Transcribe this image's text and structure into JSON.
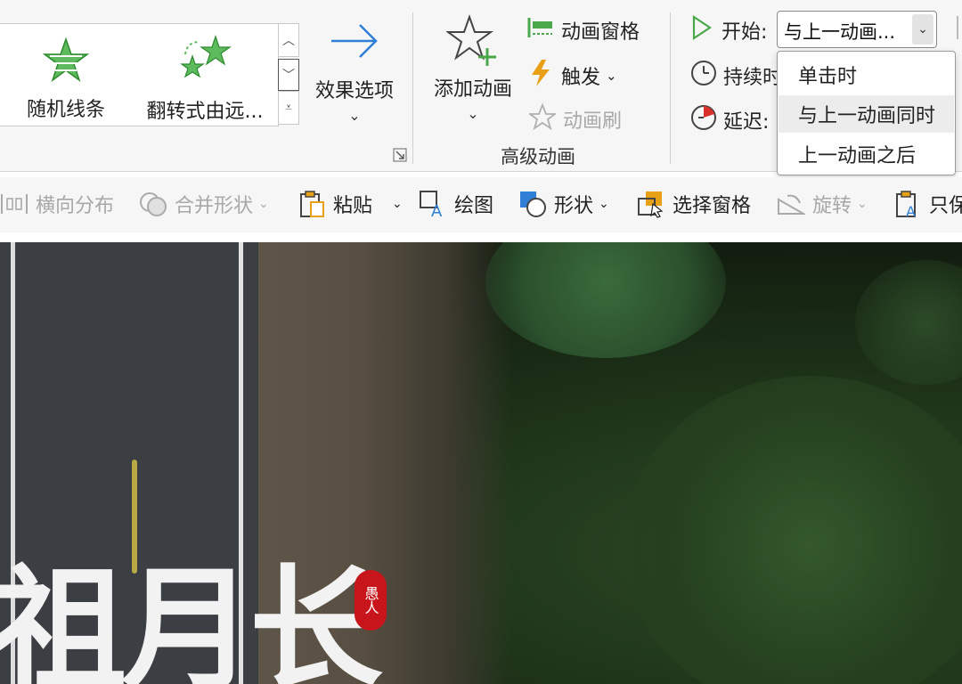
{
  "ribbon": {
    "gallery": {
      "items": [
        {
          "label": "随机线条",
          "icon": "random-bars-star-icon"
        },
        {
          "label": "翻转式由远...",
          "icon": "flip-stars-icon"
        }
      ]
    },
    "effect_options": {
      "label": "效果选项",
      "icon": "effect-options-arrow-icon"
    },
    "advanced_animation": {
      "group_label": "高级动画",
      "add_animation": {
        "label": "添加动画",
        "icon": "add-animation-star-icon"
      },
      "animation_pane": {
        "label": "动画窗格",
        "icon": "animation-pane-icon"
      },
      "trigger": {
        "label": "触发",
        "icon": "lightning-icon"
      },
      "animation_painter": {
        "label": "动画刷",
        "icon": "animation-painter-icon"
      }
    },
    "timing": {
      "start_label": "开始:",
      "start_value": "与上一动画...",
      "duration_label": "持续时",
      "delay_label": "延迟:",
      "start_options": [
        {
          "label": "单击时",
          "selected": false
        },
        {
          "label": "与上一动画同时",
          "selected": true
        },
        {
          "label": "上一动画之后",
          "selected": false
        }
      ]
    }
  },
  "toolbar2": {
    "items": [
      {
        "label": "横向分布",
        "icon": "distribute-horizontal-icon",
        "enabled": false
      },
      {
        "label": "合并形状",
        "icon": "merge-shapes-icon",
        "enabled": false
      },
      {
        "label": "粘贴",
        "icon": "paste-icon",
        "enabled": true
      },
      {
        "label": "绘图",
        "icon": "draw-text-icon",
        "enabled": true
      },
      {
        "label": "形状",
        "icon": "shapes-icon",
        "enabled": true
      },
      {
        "label": "选择窗格",
        "icon": "selection-pane-icon",
        "enabled": true
      },
      {
        "label": "旋转",
        "icon": "rotate-icon",
        "enabled": false
      },
      {
        "label": "只保",
        "icon": "keep-text-only-icon",
        "enabled": true
      }
    ]
  },
  "slide": {
    "title_text": "祖月长",
    "seal_text": "愚人"
  },
  "colors": {
    "accent_green": "#4aa84a",
    "accent_blue": "#2f7fd6",
    "trigger_orange": "#e8a016",
    "seal_red": "#c8141b"
  }
}
